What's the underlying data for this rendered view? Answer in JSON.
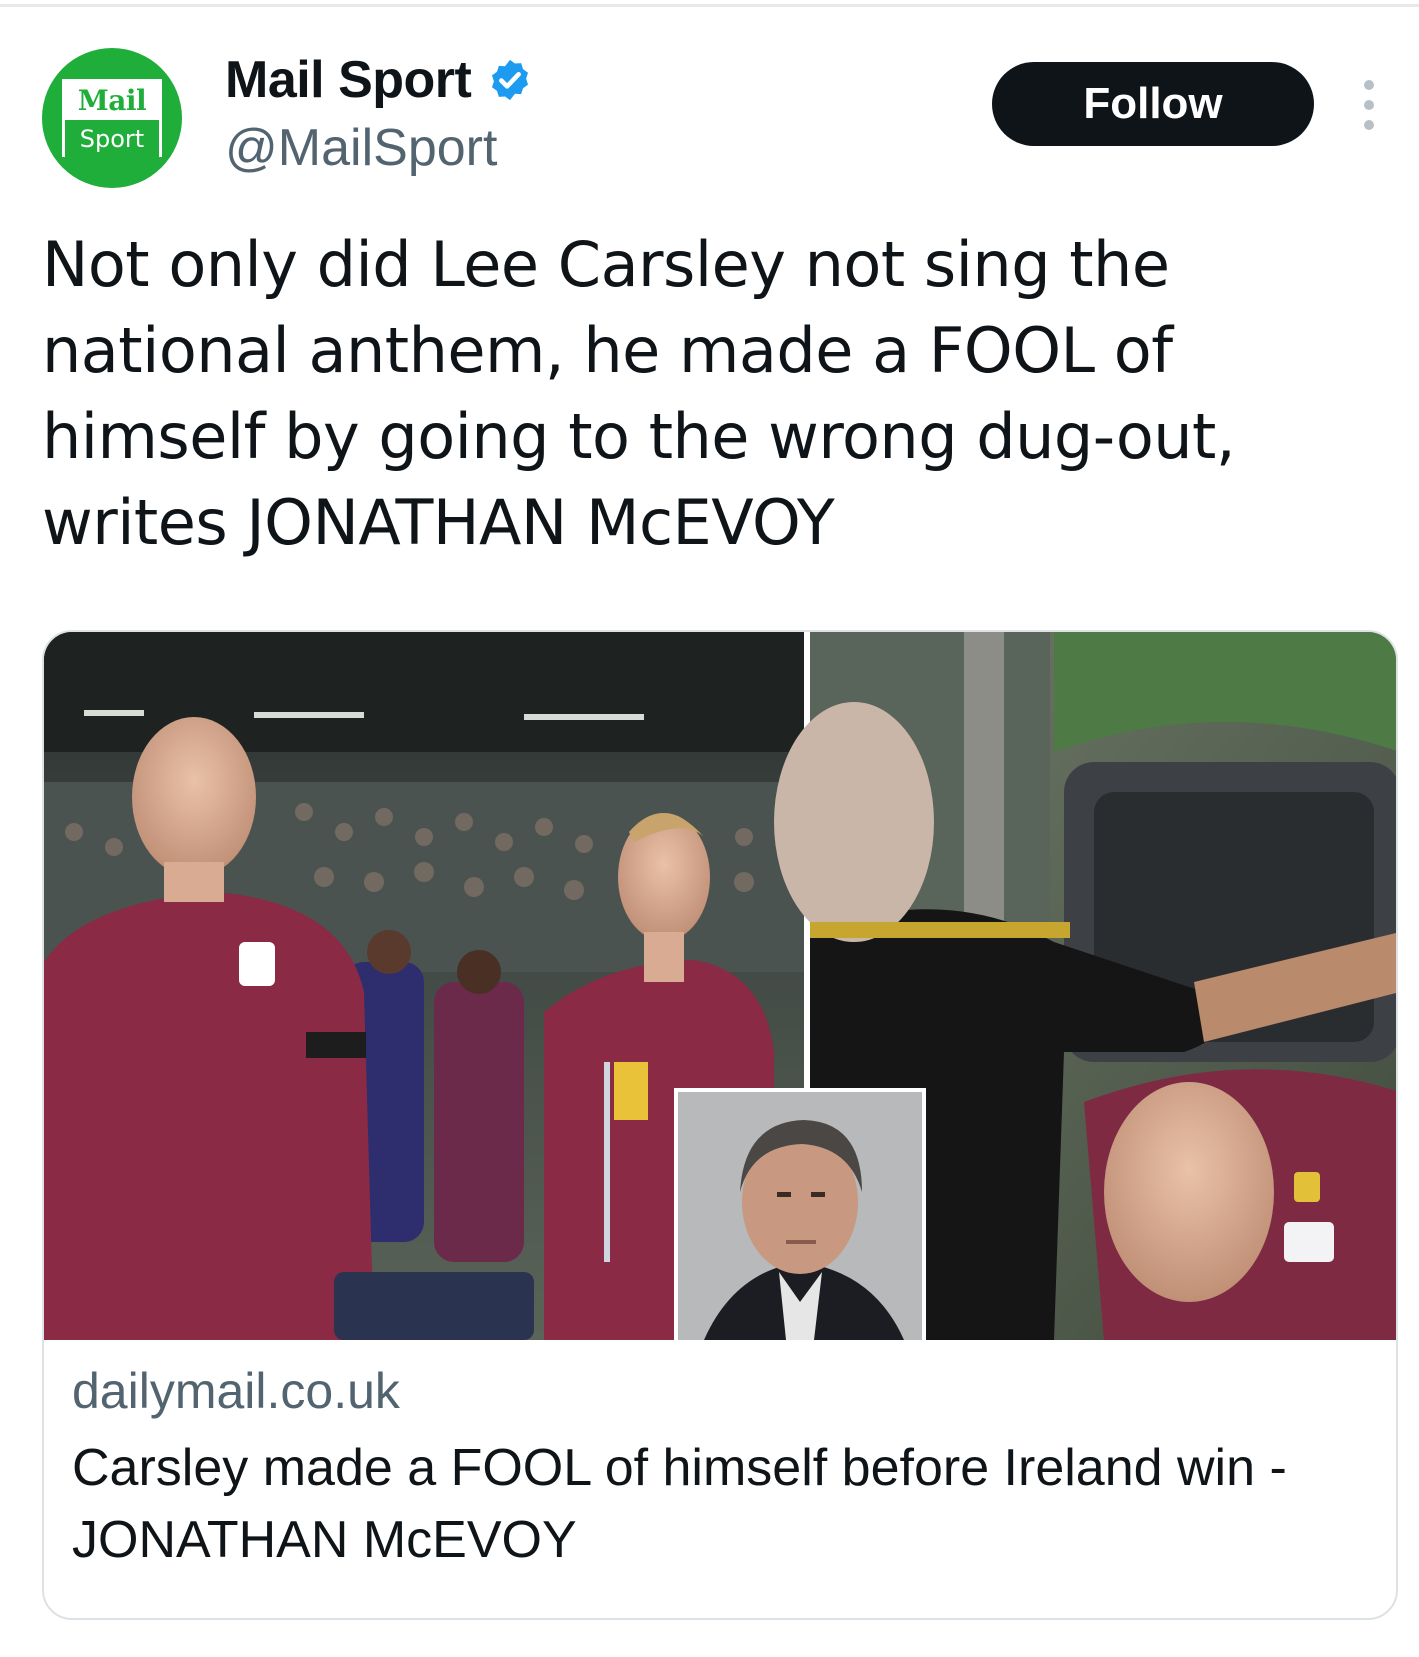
{
  "account": {
    "display_name": "Mail Sport",
    "handle": "@MailSport",
    "avatar_logo_top": "Mail",
    "avatar_logo_bottom": "Sport",
    "verified": true
  },
  "actions": {
    "follow_label": "Follow",
    "more_icon": "more-vertical-icon"
  },
  "tweet": {
    "text": "Not only did Lee Carsley not sing the national anthem, he made a FOOL of himself by going to the wrong dug-out, writes JONATHAN McEVOY"
  },
  "link_card": {
    "domain": "dailymail.co.uk",
    "title": "Carsley made a FOOL of himself before Ireland win - JONATHAN McEVOY"
  },
  "colors": {
    "brand_green": "#1fae3a",
    "verified_blue": "#1d9bf0",
    "follow_bg": "#0f1419",
    "secondary_text": "#536471"
  }
}
